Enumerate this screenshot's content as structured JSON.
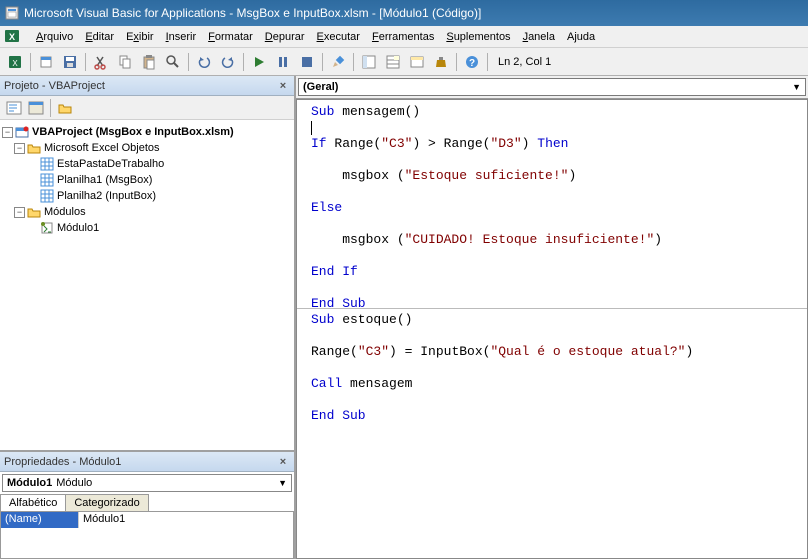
{
  "titlebar": {
    "text": "Microsoft Visual Basic for Applications - MsgBox e InputBox.xlsm - [Módulo1 (Código)]"
  },
  "menubar": {
    "items": [
      {
        "label": "Arquivo",
        "m": 0
      },
      {
        "label": "Editar",
        "m": 0
      },
      {
        "label": "Exibir",
        "m": 1
      },
      {
        "label": "Inserir",
        "m": 0
      },
      {
        "label": "Formatar",
        "m": 0
      },
      {
        "label": "Depurar",
        "m": 0
      },
      {
        "label": "Executar",
        "m": 0
      },
      {
        "label": "Ferramentas",
        "m": 0
      },
      {
        "label": "Suplementos",
        "m": 0
      },
      {
        "label": "Janela",
        "m": 0
      },
      {
        "label": "Ajuda",
        "m": 1
      }
    ]
  },
  "toolbar": {
    "status": "Ln 2, Col 1"
  },
  "project_panel": {
    "title": "Projeto - VBAProject",
    "root": "VBAProject (MsgBox e InputBox.xlsm)",
    "folder1": "Microsoft Excel Objetos",
    "items1": [
      "EstaPastaDeTrabalho",
      "Planilha1 (MsgBox)",
      "Planilha2 (InputBox)"
    ],
    "folder2": "Módulos",
    "items2": [
      "Módulo1"
    ]
  },
  "props_panel": {
    "title": "Propriedades - Módulo1",
    "obj_name": "Módulo1",
    "obj_type": "Módulo",
    "tabs": [
      "Alfabético",
      "Categorizado"
    ],
    "row_name": "(Name)",
    "row_value": "Módulo1"
  },
  "code_pane": {
    "object_dropdown": "(Geral)",
    "lines": [
      {
        "t": "kw",
        "v": "Sub"
      },
      {
        "t": "",
        "v": " mensagem()"
      },
      null,
      {
        "t": "cursor"
      },
      null,
      {
        "t": "kw",
        "v": "If"
      },
      {
        "t": "",
        "v": " Range("
      },
      {
        "t": "str",
        "v": "\"C3\""
      },
      {
        "t": "",
        "v": ") > Range("
      },
      {
        "t": "str",
        "v": "\"D3\""
      },
      {
        "t": "",
        "v": ") "
      },
      {
        "t": "kw",
        "v": "Then"
      },
      null,
      null,
      {
        "t": "",
        "v": "    msgbox ("
      },
      {
        "t": "str",
        "v": "\"Estoque suficiente!\""
      },
      {
        "t": "",
        "v": ")"
      },
      null,
      null,
      {
        "t": "kw",
        "v": "Else"
      },
      null,
      null,
      {
        "t": "",
        "v": "    msgbox ("
      },
      {
        "t": "str",
        "v": "\"CUIDADO! Estoque insuficiente!\""
      },
      {
        "t": "",
        "v": ")"
      },
      null,
      null,
      {
        "t": "kw",
        "v": "End If"
      },
      null,
      null,
      {
        "t": "kw",
        "v": "End Sub"
      },
      null,
      {
        "t": "hr"
      },
      {
        "t": "kw",
        "v": "Sub"
      },
      {
        "t": "",
        "v": " estoque()"
      },
      null,
      null,
      {
        "t": "",
        "v": "Range("
      },
      {
        "t": "str",
        "v": "\"C3\""
      },
      {
        "t": "",
        "v": ") = InputBox("
      },
      {
        "t": "str",
        "v": "\"Qual é o estoque atual?\""
      },
      {
        "t": "",
        "v": ")"
      },
      null,
      null,
      {
        "t": "kw",
        "v": "Call"
      },
      {
        "t": "",
        "v": " mensagem"
      },
      null,
      null,
      {
        "t": "kw",
        "v": "End Sub"
      },
      null
    ]
  }
}
